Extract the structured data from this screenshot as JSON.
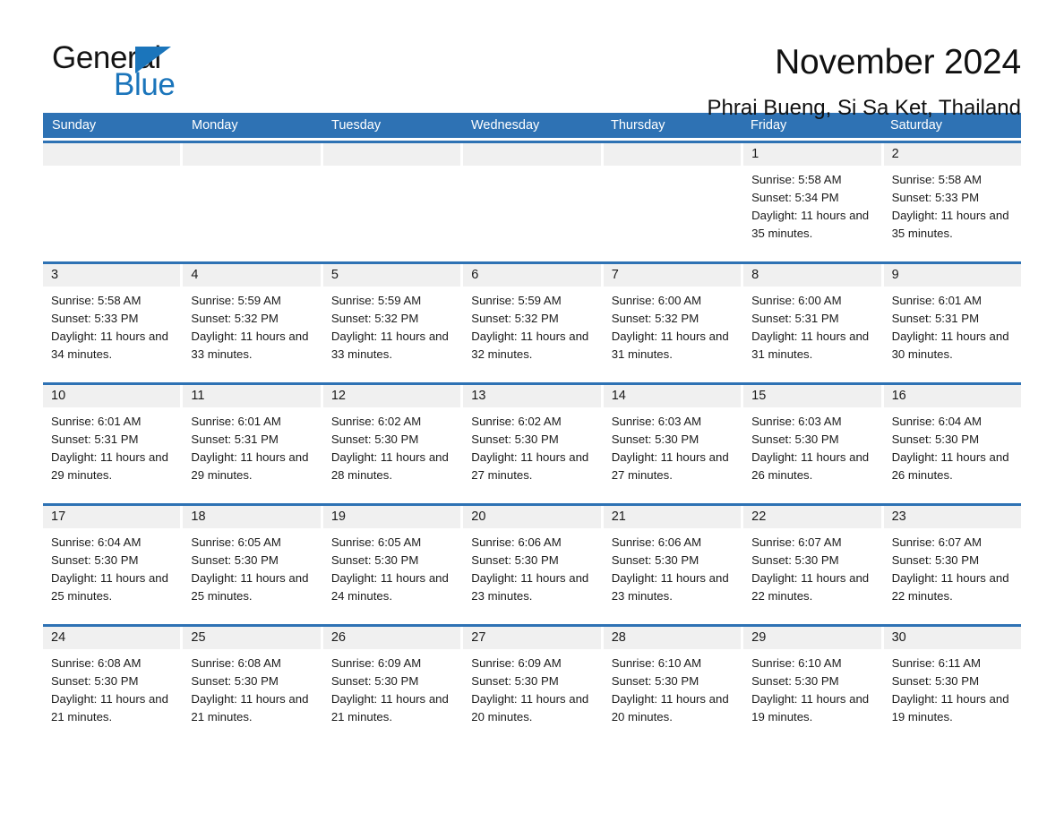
{
  "brand": {
    "name_top": "General",
    "name_bottom": "Blue",
    "triangle_icon": "brand-triangle-icon",
    "accent_color": "#1b75bb"
  },
  "header": {
    "month_title": "November 2024",
    "location": "Phrai Bueng, Si Sa Ket, Thailand"
  },
  "theme": {
    "header_blue": "#2e72b4",
    "daynum_band": "#f0f0f0",
    "cell_background": "#ffffff",
    "text_color": "#1a1a1a"
  },
  "weekdays": [
    "Sunday",
    "Monday",
    "Tuesday",
    "Wednesday",
    "Thursday",
    "Friday",
    "Saturday"
  ],
  "weeks": [
    [
      {
        "day": "",
        "empty": true
      },
      {
        "day": "",
        "empty": true
      },
      {
        "day": "",
        "empty": true
      },
      {
        "day": "",
        "empty": true
      },
      {
        "day": "",
        "empty": true
      },
      {
        "day": "1",
        "sunrise": "Sunrise: 5:58 AM",
        "sunset": "Sunset: 5:34 PM",
        "daylight": "Daylight: 11 hours and 35 minutes."
      },
      {
        "day": "2",
        "sunrise": "Sunrise: 5:58 AM",
        "sunset": "Sunset: 5:33 PM",
        "daylight": "Daylight: 11 hours and 35 minutes."
      }
    ],
    [
      {
        "day": "3",
        "sunrise": "Sunrise: 5:58 AM",
        "sunset": "Sunset: 5:33 PM",
        "daylight": "Daylight: 11 hours and 34 minutes."
      },
      {
        "day": "4",
        "sunrise": "Sunrise: 5:59 AM",
        "sunset": "Sunset: 5:32 PM",
        "daylight": "Daylight: 11 hours and 33 minutes."
      },
      {
        "day": "5",
        "sunrise": "Sunrise: 5:59 AM",
        "sunset": "Sunset: 5:32 PM",
        "daylight": "Daylight: 11 hours and 33 minutes."
      },
      {
        "day": "6",
        "sunrise": "Sunrise: 5:59 AM",
        "sunset": "Sunset: 5:32 PM",
        "daylight": "Daylight: 11 hours and 32 minutes."
      },
      {
        "day": "7",
        "sunrise": "Sunrise: 6:00 AM",
        "sunset": "Sunset: 5:32 PM",
        "daylight": "Daylight: 11 hours and 31 minutes."
      },
      {
        "day": "8",
        "sunrise": "Sunrise: 6:00 AM",
        "sunset": "Sunset: 5:31 PM",
        "daylight": "Daylight: 11 hours and 31 minutes."
      },
      {
        "day": "9",
        "sunrise": "Sunrise: 6:01 AM",
        "sunset": "Sunset: 5:31 PM",
        "daylight": "Daylight: 11 hours and 30 minutes."
      }
    ],
    [
      {
        "day": "10",
        "sunrise": "Sunrise: 6:01 AM",
        "sunset": "Sunset: 5:31 PM",
        "daylight": "Daylight: 11 hours and 29 minutes."
      },
      {
        "day": "11",
        "sunrise": "Sunrise: 6:01 AM",
        "sunset": "Sunset: 5:31 PM",
        "daylight": "Daylight: 11 hours and 29 minutes."
      },
      {
        "day": "12",
        "sunrise": "Sunrise: 6:02 AM",
        "sunset": "Sunset: 5:30 PM",
        "daylight": "Daylight: 11 hours and 28 minutes."
      },
      {
        "day": "13",
        "sunrise": "Sunrise: 6:02 AM",
        "sunset": "Sunset: 5:30 PM",
        "daylight": "Daylight: 11 hours and 27 minutes."
      },
      {
        "day": "14",
        "sunrise": "Sunrise: 6:03 AM",
        "sunset": "Sunset: 5:30 PM",
        "daylight": "Daylight: 11 hours and 27 minutes."
      },
      {
        "day": "15",
        "sunrise": "Sunrise: 6:03 AM",
        "sunset": "Sunset: 5:30 PM",
        "daylight": "Daylight: 11 hours and 26 minutes."
      },
      {
        "day": "16",
        "sunrise": "Sunrise: 6:04 AM",
        "sunset": "Sunset: 5:30 PM",
        "daylight": "Daylight: 11 hours and 26 minutes."
      }
    ],
    [
      {
        "day": "17",
        "sunrise": "Sunrise: 6:04 AM",
        "sunset": "Sunset: 5:30 PM",
        "daylight": "Daylight: 11 hours and 25 minutes."
      },
      {
        "day": "18",
        "sunrise": "Sunrise: 6:05 AM",
        "sunset": "Sunset: 5:30 PM",
        "daylight": "Daylight: 11 hours and 25 minutes."
      },
      {
        "day": "19",
        "sunrise": "Sunrise: 6:05 AM",
        "sunset": "Sunset: 5:30 PM",
        "daylight": "Daylight: 11 hours and 24 minutes."
      },
      {
        "day": "20",
        "sunrise": "Sunrise: 6:06 AM",
        "sunset": "Sunset: 5:30 PM",
        "daylight": "Daylight: 11 hours and 23 minutes."
      },
      {
        "day": "21",
        "sunrise": "Sunrise: 6:06 AM",
        "sunset": "Sunset: 5:30 PM",
        "daylight": "Daylight: 11 hours and 23 minutes."
      },
      {
        "day": "22",
        "sunrise": "Sunrise: 6:07 AM",
        "sunset": "Sunset: 5:30 PM",
        "daylight": "Daylight: 11 hours and 22 minutes."
      },
      {
        "day": "23",
        "sunrise": "Sunrise: 6:07 AM",
        "sunset": "Sunset: 5:30 PM",
        "daylight": "Daylight: 11 hours and 22 minutes."
      }
    ],
    [
      {
        "day": "24",
        "sunrise": "Sunrise: 6:08 AM",
        "sunset": "Sunset: 5:30 PM",
        "daylight": "Daylight: 11 hours and 21 minutes."
      },
      {
        "day": "25",
        "sunrise": "Sunrise: 6:08 AM",
        "sunset": "Sunset: 5:30 PM",
        "daylight": "Daylight: 11 hours and 21 minutes."
      },
      {
        "day": "26",
        "sunrise": "Sunrise: 6:09 AM",
        "sunset": "Sunset: 5:30 PM",
        "daylight": "Daylight: 11 hours and 21 minutes."
      },
      {
        "day": "27",
        "sunrise": "Sunrise: 6:09 AM",
        "sunset": "Sunset: 5:30 PM",
        "daylight": "Daylight: 11 hours and 20 minutes."
      },
      {
        "day": "28",
        "sunrise": "Sunrise: 6:10 AM",
        "sunset": "Sunset: 5:30 PM",
        "daylight": "Daylight: 11 hours and 20 minutes."
      },
      {
        "day": "29",
        "sunrise": "Sunrise: 6:10 AM",
        "sunset": "Sunset: 5:30 PM",
        "daylight": "Daylight: 11 hours and 19 minutes."
      },
      {
        "day": "30",
        "sunrise": "Sunrise: 6:11 AM",
        "sunset": "Sunset: 5:30 PM",
        "daylight": "Daylight: 11 hours and 19 minutes."
      }
    ]
  ]
}
